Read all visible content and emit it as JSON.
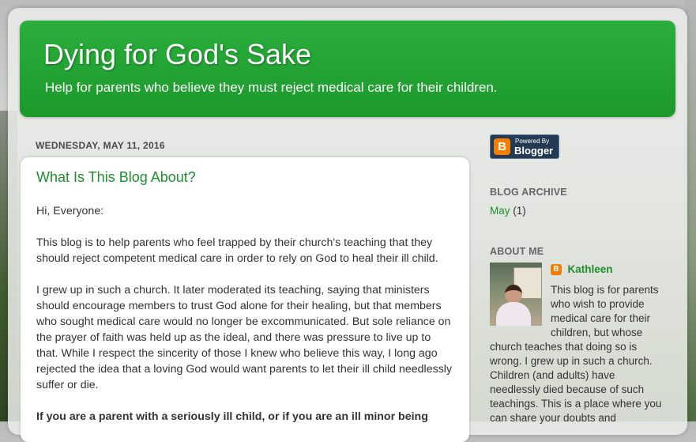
{
  "header": {
    "title": "Dying for God's Sake",
    "description": "Help for parents who believe they must reject medical care for their children."
  },
  "post": {
    "date": "WEDNESDAY, MAY 11, 2016",
    "title": "What Is This Blog About?",
    "paragraphs": [
      "Hi, Everyone:",
      "This blog is to help parents who feel trapped by their church's teaching that they should reject competent medical care in order to rely on God to heal their ill child.",
      "I grew up in such a church. It later moderated its teaching, saying that ministers should encourage members to trust God alone for their healing, but that members who sought medical care would no longer be excommunicated. But sole reliance on the prayer of faith was held up as the ideal, and there was pressure to live up to that. While I respect the sincerity of those I knew who believe this way, I long ago rejected the idea that a loving God would want parents to let their ill child needlessly suffer or die."
    ],
    "bold_paragraph": "If you are a parent with a seriously ill child, or if you are an ill minor being"
  },
  "sidebar": {
    "badge": {
      "small": "Powered By",
      "big": "Blogger",
      "icon": "B"
    },
    "archive": {
      "title": "BLOG ARCHIVE",
      "month": "May",
      "count": "(1)"
    },
    "about": {
      "title": "ABOUT ME",
      "name": "Kathleen",
      "profile_icon": "B",
      "text": "This blog is for parents who wish to provide medical care for their children, but whose church teaches that doing so is wrong. I grew up in such a church. Children (and adults) have needlessly died because of such teachings. This is a place where you can share your doubts and"
    }
  },
  "colors": {
    "header_green": "#1c9a2c",
    "link_green": "#1f8f2d",
    "blogger_orange": "#f57d00"
  }
}
